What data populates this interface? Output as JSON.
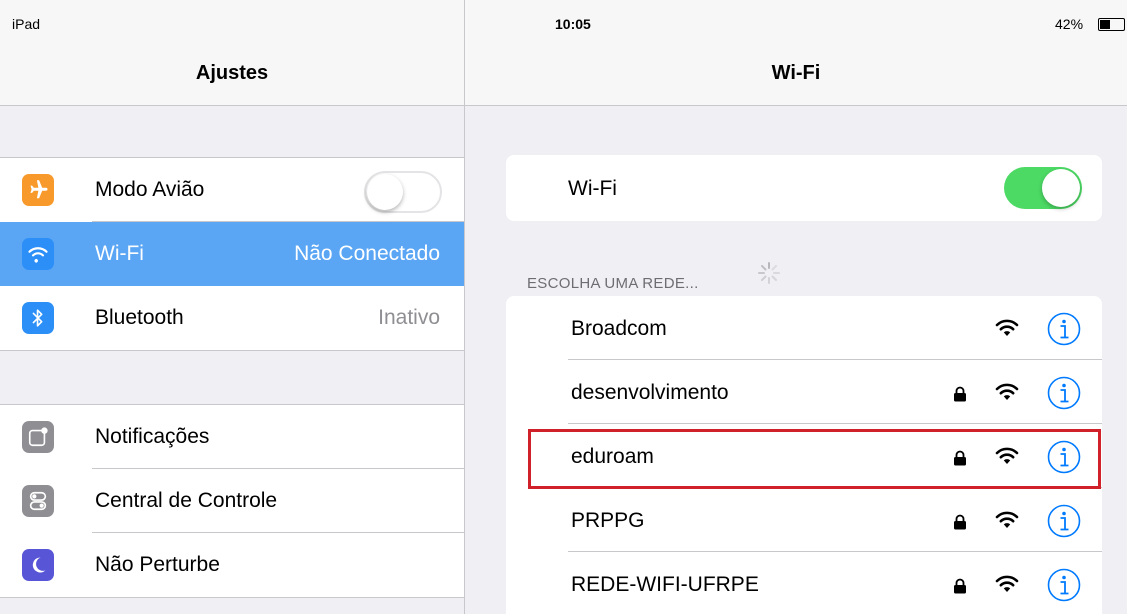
{
  "status_bar": {
    "device": "iPad",
    "time": "10:05",
    "battery_percent": "42%",
    "battery_level": 0.42
  },
  "left": {
    "title": "Ajustes",
    "group1": [
      {
        "label": "Modo Avião",
        "icon": "airplane-icon",
        "icon_color": "#f89a2b",
        "toggle": false
      },
      {
        "label": "Wi-Fi",
        "value": "Não Conectado",
        "icon": "wifi-icon",
        "icon_color": "#2b8ff7",
        "selected": true
      },
      {
        "label": "Bluetooth",
        "value": "Inativo",
        "icon": "bluetooth-icon",
        "icon_color": "#2b8ff7"
      }
    ],
    "group2": [
      {
        "label": "Notificações",
        "icon": "notifications-icon",
        "icon_color": "#8e8e93"
      },
      {
        "label": "Central de Controle",
        "icon": "control-center-icon",
        "icon_color": "#8e8e93"
      },
      {
        "label": "Não Perturbe",
        "icon": "moon-icon",
        "icon_color": "#5856d6"
      }
    ]
  },
  "right": {
    "title": "Wi-Fi",
    "wifi_label": "Wi-Fi",
    "wifi_enabled": true,
    "section_header": "ESCOLHA UMA REDE...",
    "networks": [
      {
        "name": "Broadcom",
        "locked": false
      },
      {
        "name": "desenvolvimento",
        "locked": true
      },
      {
        "name": "eduroam",
        "locked": true,
        "highlighted": true
      },
      {
        "name": "PRPPG",
        "locked": true
      },
      {
        "name": "REDE-WIFI-UFRPE",
        "locked": true
      }
    ]
  },
  "colors": {
    "accent": "#007aff",
    "selected_row": "#5aa6f5",
    "toggle_on": "#4cd964",
    "highlight": "#d0202a"
  }
}
